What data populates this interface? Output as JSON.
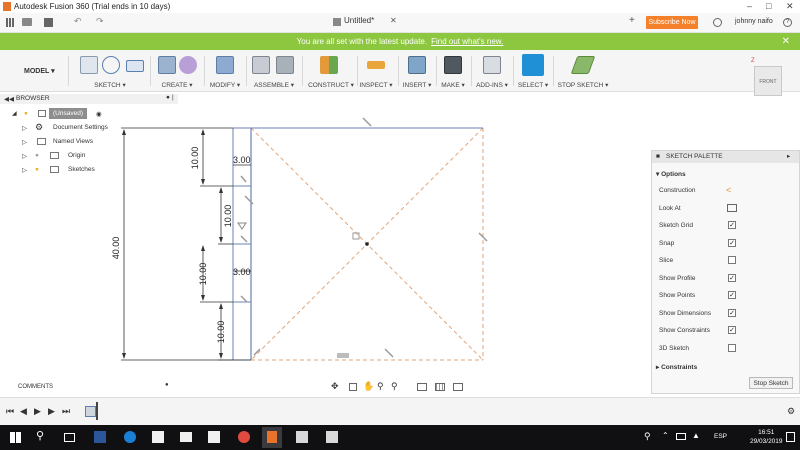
{
  "titlebar": {
    "title": "Autodesk Fusion 360 (Trial ends in 10 days)"
  },
  "approw": {
    "doc_tab": "Untitled*",
    "subscribe": "Subscribe Now",
    "user": "johnny naifo"
  },
  "banner": {
    "text": "You are all set with the latest update.",
    "link": "Find out what's new."
  },
  "toolbar": {
    "workspace": "MODEL",
    "groups": [
      "SKETCH",
      "CREATE",
      "MODIFY",
      "ASSEMBLE",
      "CONSTRUCT",
      "INSPECT",
      "INSERT",
      "MAKE",
      "ADD-INS",
      "SELECT",
      "STOP SKETCH"
    ]
  },
  "viewcube": {
    "face": "FRONT",
    "axis": "Z"
  },
  "browser": {
    "title": "BROWSER",
    "items": [
      "(Unsaved)",
      "Document Settings",
      "Named Views",
      "Origin",
      "Sketches"
    ]
  },
  "palette": {
    "title": "SKETCH PALETTE",
    "options_label": "Options",
    "rows": [
      {
        "label": "Construction",
        "checked": ""
      },
      {
        "label": "Look At",
        "checked": ""
      },
      {
        "label": "Sketch Grid",
        "checked": "✓"
      },
      {
        "label": "Snap",
        "checked": "✓"
      },
      {
        "label": "Slice",
        "checked": ""
      },
      {
        "label": "Show Profile",
        "checked": "✓"
      },
      {
        "label": "Show Points",
        "checked": "✓"
      },
      {
        "label": "Show Dimensions",
        "checked": "✓"
      },
      {
        "label": "Show Constraints",
        "checked": "✓"
      },
      {
        "label": "3D Sketch",
        "checked": ""
      }
    ],
    "constraints_label": "Constraints",
    "stop_label": "Stop Sketch"
  },
  "comments": {
    "label": "COMMENTS"
  },
  "sketch": {
    "dim_total": "40.00",
    "dim_seg": "10.00",
    "dim_width": "3.00"
  },
  "taskbar": {
    "time": "16:51",
    "date": "29/03/2019",
    "lang": "ESP"
  },
  "colors": {
    "accent": "#8dc63f",
    "subscribe": "#f4802a",
    "select": "#1f8fd6"
  }
}
